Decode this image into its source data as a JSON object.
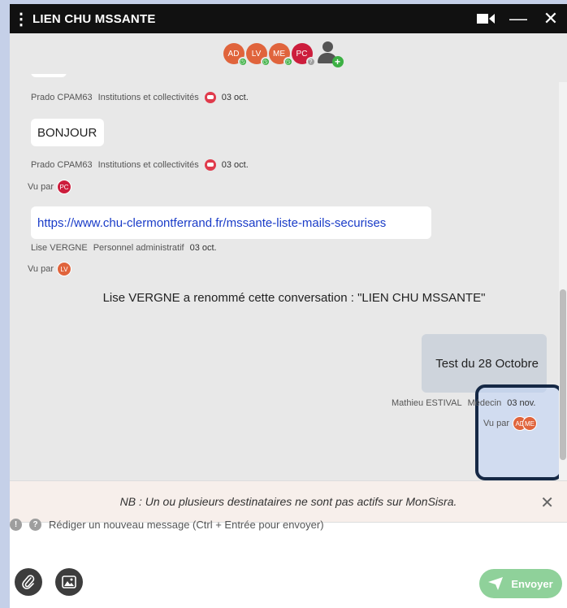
{
  "header": {
    "title": "LIEN CHU MSSANTE",
    "menu_icon": "kebab-menu-icon",
    "video_icon": "video-camera-icon",
    "minimize": "—",
    "close": "✕"
  },
  "participants": [
    {
      "initials": "AD",
      "color": "#e0643c",
      "status_color": "#3cb043",
      "status_icon": "clock-icon"
    },
    {
      "initials": "LV",
      "color": "#e0643c",
      "status_color": "#3cb043",
      "status_icon": "clock-icon"
    },
    {
      "initials": "ME",
      "color": "#e0643c",
      "status_color": "#3cb043",
      "status_icon": "clock-icon"
    },
    {
      "initials": "PC",
      "color": "#cc1d3c",
      "status_color": "#9e9e9e",
      "status_icon": "question-icon"
    }
  ],
  "messages": [
    {
      "sender": "Prado CPAM63",
      "role": "Institutions et collectivités",
      "date": "03 oct."
    },
    {
      "text": "BONJOUR",
      "sender": "Prado CPAM63",
      "role": "Institutions et collectivités",
      "date": "03 oct.",
      "seen_label": "Vu par",
      "seen_by": [
        "PC"
      ]
    },
    {
      "text": "https://www.chu-clermontferrand.fr/mssante-liste-mails-securises",
      "sender": "Lise VERGNE",
      "role": "Personnel administratif",
      "date": "03 oct.",
      "seen_label": "Vu par",
      "seen_by": [
        "LV"
      ]
    }
  ],
  "system_message": "Lise VERGNE a renommé cette conversation : \"LIEN CHU MSSANTE\"",
  "my_message": {
    "text": "Test du 28 Octobre",
    "sender": "Mathieu ESTIVAL",
    "role": "Médecin",
    "date": "03 nov.",
    "seen_label": "Vu par",
    "seen_by": [
      "AD",
      "ME"
    ]
  },
  "notice": {
    "text": "NB : Un ou plusieurs destinataires ne sont pas actifs sur MonSisra.",
    "close": "✕"
  },
  "composer": {
    "placeholder": "Rédiger un nouveau message (Ctrl + Entrée pour envoyer)",
    "warning_icon": "!",
    "help_icon": "?",
    "send_label": "Envoyer"
  },
  "colors": {
    "titlebar": "#111111",
    "chat_background": "#e8e8e8",
    "avatar_orange": "#e0643c",
    "avatar_red": "#cc1d3c",
    "status_online": "#3cb043",
    "send_button": "#8fd19a",
    "link": "#1a3cc8"
  }
}
